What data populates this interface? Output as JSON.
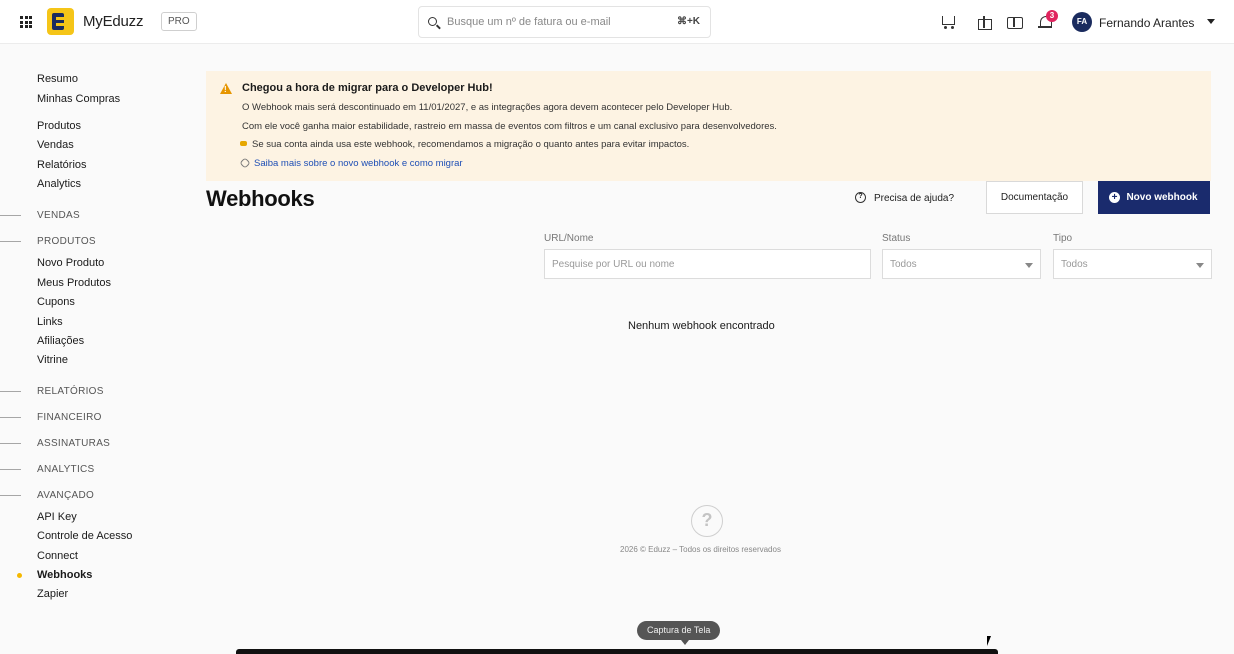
{
  "topbar": {
    "brand": "MyEduzz",
    "plan_badge": "PRO",
    "search_placeholder": "Busque um nº de fatura ou e-mail",
    "search_shortcut": "⌘+K",
    "notification_count": "3",
    "user_initials": "FA",
    "user_name": "Fernando Arantes"
  },
  "sidebar": {
    "group1": [
      "Resumo",
      "Minhas Compras"
    ],
    "group2": [
      "Produtos",
      "Vendas",
      "Relatórios",
      "Analytics"
    ],
    "sections": {
      "vendas": "VENDAS",
      "produtos": "PRODUTOS",
      "relatorios": "RELATÓRIOS",
      "financeiro": "FINANCEIRO",
      "assinaturas": "ASSINATURAS",
      "analytics": "ANALYTICS",
      "avancado": "AVANÇADO"
    },
    "produtos_items": [
      "Novo Produto",
      "Meus Produtos",
      "Cupons",
      "Links",
      "Afiliações",
      "Vitrine"
    ],
    "avancado_items": [
      "API Key",
      "Controle de Acesso",
      "Connect",
      "Webhooks",
      "Zapier"
    ],
    "active_item": "Webhooks"
  },
  "banner": {
    "title": "Chegou a hora de migrar para o Developer Hub!",
    "line1": "O Webhook mais será descontinuado em 11/01/2027, e as integrações agora devem acontecer pelo Developer Hub.",
    "line2": "Com ele você ganha maior estabilidade, rastreio em massa de eventos com filtros e um canal exclusivo para desenvolvedores.",
    "line3": "Se sua conta ainda usa este webhook, recomendamos a migração o quanto antes para evitar impactos.",
    "link": "Saiba mais sobre o novo webhook e como migrar"
  },
  "page": {
    "title": "Webhooks",
    "help_label": "Precisa de ajuda?",
    "doc_button": "Documentação",
    "new_button": "Novo webhook"
  },
  "filters": {
    "url_label": "URL/Nome",
    "url_placeholder": "Pesquise por URL ou nome",
    "status_label": "Status",
    "status_value": "Todos",
    "type_label": "Tipo",
    "type_value": "Todos"
  },
  "empty_message": "Nenhum webhook encontrado",
  "footer": {
    "copyright": "2026 © Eduzz – Todos os direitos reservados",
    "toast": "Captura de Tela"
  }
}
